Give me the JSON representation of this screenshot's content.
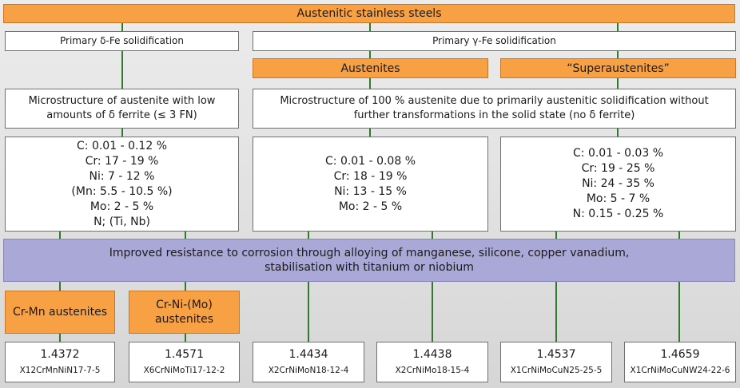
{
  "header": {
    "title": "Austenitic stainless steels"
  },
  "primary": {
    "delta": "Primary δ-Fe solidification",
    "gamma": "Primary γ-Fe solidification"
  },
  "groups": {
    "austenites": "Austenites",
    "superaustenites": "“Superaustenites”"
  },
  "microstructure": {
    "delta": [
      "Microstructure of austenite with low",
      "amounts of δ ferrite (≤ 3 FN)"
    ],
    "gamma": [
      "Microstructure of 100 % austenite due to primarily austenitic solidification without",
      "further transformations in the solid state (no δ ferrite)"
    ]
  },
  "composition": {
    "delta": [
      "C: 0.01 - 0.12 %",
      "Cr: 17 - 19 %",
      "Ni: 7 - 12 %",
      "(Mn: 5.5 - 10.5 %)",
      "Mo: 2 - 5 %",
      "N; (Ti, Nb)"
    ],
    "austenites": [
      "C: 0.01 - 0.08 %",
      "Cr: 18 - 19 %",
      "Ni: 13 - 15 %",
      "Mo: 2 - 5 %"
    ],
    "superaustenites": [
      "C: 0.01 - 0.03 %",
      "Cr: 19 - 25 %",
      "Ni: 24 - 35 %",
      "Mo: 5 - 7 %",
      "N: 0.15 - 0.25 %"
    ]
  },
  "improved": [
    "Improved resistance to corrosion through alloying of manganese, silicone, copper vanadium,",
    "stabilisation with titanium or niobium"
  ],
  "subtypes": {
    "crmn": "Cr-Mn austenites",
    "crnimo": [
      "Cr-Ni-(Mo)",
      "austenites"
    ]
  },
  "grades": [
    {
      "number": "1.4372",
      "designation": "X12CrMnNiN17-7-5"
    },
    {
      "number": "1.4571",
      "designation": "X6CrNiMoTi17-12-2"
    },
    {
      "number": "1.4434",
      "designation": "X2CrNiMoN18-12-4"
    },
    {
      "number": "1.4438",
      "designation": "X2CrNiMo18-15-4"
    },
    {
      "number": "1.4537",
      "designation": "X1CrNiMoCuN25-25-5"
    },
    {
      "number": "1.4659",
      "designation": "X1CrNiMoCuNW24-22-6"
    }
  ],
  "colors": {
    "orange": "#f7a044",
    "purple": "#a9a8d6",
    "connector": "#2f7a2f"
  }
}
